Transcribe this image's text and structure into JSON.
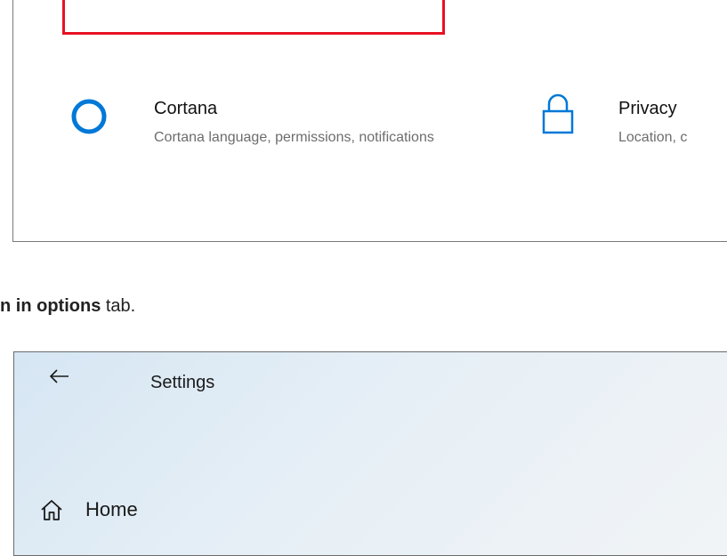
{
  "top_panel": {
    "tiles": [
      {
        "title": "Cortana",
        "description": "Cortana language, permissions, notifications",
        "icon": "cortana-ring-icon"
      },
      {
        "title": "Privacy",
        "description": "Location, c",
        "icon": "lock-icon"
      }
    ],
    "highlight_color": "#e81123"
  },
  "caption": {
    "bold_text": "n in options",
    "rest_text": " tab."
  },
  "settings_window": {
    "title": "Settings",
    "back_icon": "back-arrow-icon",
    "nav_items": [
      {
        "label": "Home",
        "icon": "home-icon"
      }
    ]
  },
  "colors": {
    "accent": "#0078d7",
    "tile_description": "#6d6d6d"
  }
}
